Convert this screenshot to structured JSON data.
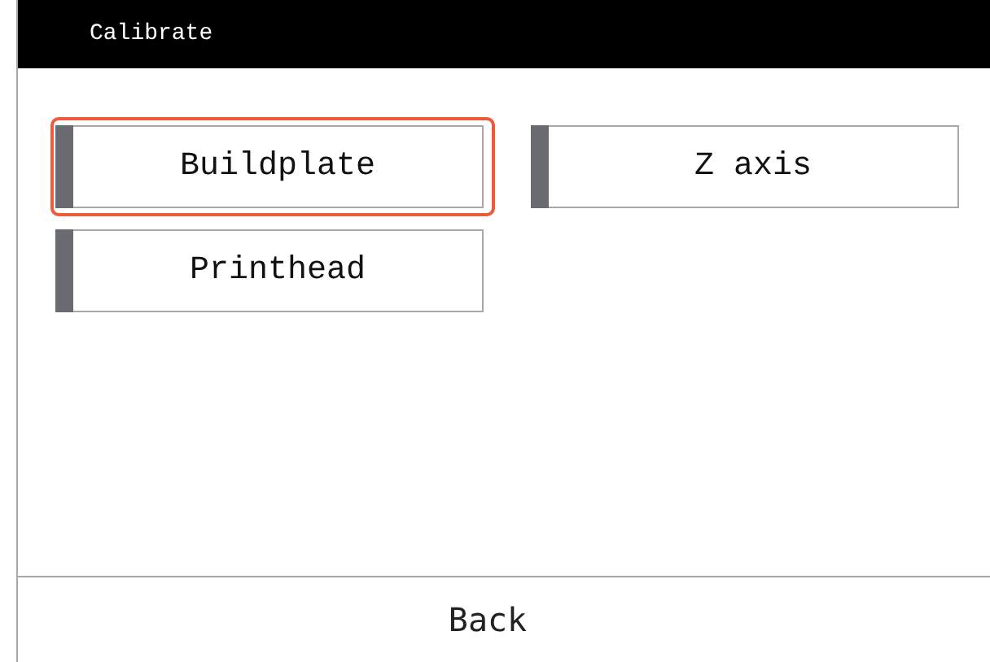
{
  "window": {
    "title": "Calibrate"
  },
  "options": [
    {
      "label": "Buildplate",
      "selected": true
    },
    {
      "label": "Z axis",
      "selected": false
    },
    {
      "label": "Printhead",
      "selected": false
    }
  ],
  "footer": {
    "back": "Back"
  }
}
